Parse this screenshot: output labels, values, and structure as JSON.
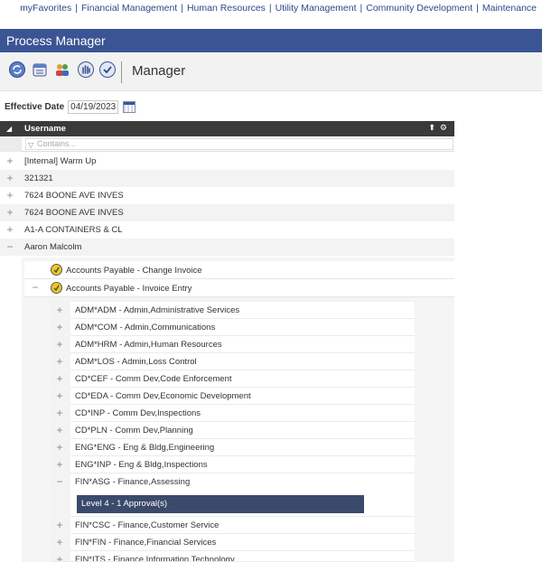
{
  "nav": {
    "items": [
      "myFavorites",
      "Financial Management",
      "Human Resources",
      "Utility Management",
      "Community Development",
      "Maintenance"
    ],
    "separator": "|"
  },
  "title": "Process Manager",
  "toolbar": {
    "label": "Manager",
    "icons": [
      "refresh-icon",
      "calendar-icon",
      "users-icon",
      "hand-icon",
      "check-icon"
    ]
  },
  "effective_date": {
    "label": "Effective Date",
    "value": "04/19/2023"
  },
  "grid": {
    "column": "Username",
    "filter_placeholder": "Contains...",
    "rows": [
      {
        "expander": "+",
        "label": "[Internal] Warm Up"
      },
      {
        "expander": "+",
        "label": "321321"
      },
      {
        "expander": "+",
        "label": "7624 BOONE AVE INVES"
      },
      {
        "expander": "+",
        "label": "7624 BOONE AVE INVES"
      },
      {
        "expander": "+",
        "label": "A1-A CONTAINERS & CL"
      },
      {
        "expander": "−",
        "label": "Aaron Malcolm"
      }
    ],
    "sub_rows": [
      {
        "expander": "",
        "label": "Accounts Payable - Change Invoice"
      },
      {
        "expander": "−",
        "label": "Accounts Payable - Invoice Entry"
      }
    ],
    "leaves": [
      {
        "expander": "+",
        "label": "ADM*ADM - Admin,Administrative Services"
      },
      {
        "expander": "+",
        "label": "ADM*COM - Admin,Communications"
      },
      {
        "expander": "+",
        "label": "ADM*HRM - Admin,Human Resources"
      },
      {
        "expander": "+",
        "label": "ADM*LOS - Admin,Loss Control"
      },
      {
        "expander": "+",
        "label": "CD*CEF - Comm Dev,Code Enforcement"
      },
      {
        "expander": "+",
        "label": "CD*EDA - Comm Dev,Economic Development"
      },
      {
        "expander": "+",
        "label": "CD*INP - Comm Dev,Inspections"
      },
      {
        "expander": "+",
        "label": "CD*PLN - Comm Dev,Planning"
      },
      {
        "expander": "+",
        "label": "ENG*ENG - Eng & Bldg,Engineering"
      },
      {
        "expander": "+",
        "label": "ENG*INP - Eng & Bldg,Inspections"
      },
      {
        "expander": "−",
        "label": "FIN*ASG - Finance,Assessing"
      }
    ],
    "level_bar": "Level 4 - 1 Approval(s)",
    "leaves_after": [
      {
        "expander": "+",
        "label": "FIN*CSC - Finance,Customer Service"
      },
      {
        "expander": "+",
        "label": "FIN*FIN - Finance,Financial Services"
      },
      {
        "expander": "+",
        "label": "FIN*ITS - Finance,Information Technology"
      }
    ]
  },
  "colors": {
    "accent": "#3b5494",
    "header": "#3a3a3a",
    "level_bar": "#3b4a6b"
  }
}
